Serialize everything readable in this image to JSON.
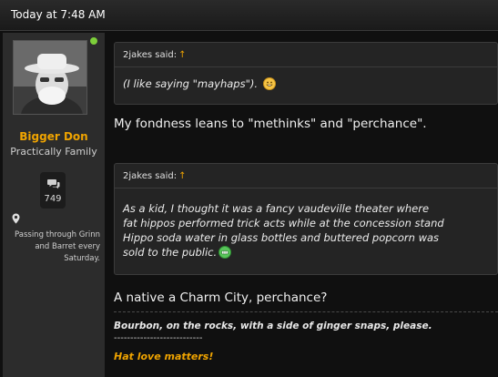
{
  "post": {
    "timestamp": "Today at 7:48 AM"
  },
  "user": {
    "name": "Bigger Don",
    "title": "Practically Family",
    "message_count": "749",
    "location": "Passing through Grinn and Barret every Saturday."
  },
  "quote1": {
    "author": "2jakes said:",
    "arrow": "↑",
    "text": "(I like saying \"mayhaps\")."
  },
  "reply1": "My fondness leans to \"methinks\" and \"perchance\".",
  "quote2": {
    "author": "2jakes said:",
    "arrow": "↑",
    "line1": "As a kid, I thought it was a fancy vaudeville theater where",
    "line2": "fat hippos performed trick acts while at the concession stand",
    "line3": "Hippo soda water in glass bottles and buttered popcorn was",
    "line4": "sold to the public."
  },
  "reply2": "A native a Charm City, perchance?",
  "signature": {
    "line1": "Bourbon, on the rocks, with a side of ginger snaps, please.",
    "line2": "---------------------------",
    "line3": "Hat love matters!"
  },
  "colors": {
    "accent": "#f0a400",
    "online": "#7dcf3a"
  },
  "icons": {
    "messages": "chat-bubbles-icon",
    "location": "map-pin-icon"
  }
}
